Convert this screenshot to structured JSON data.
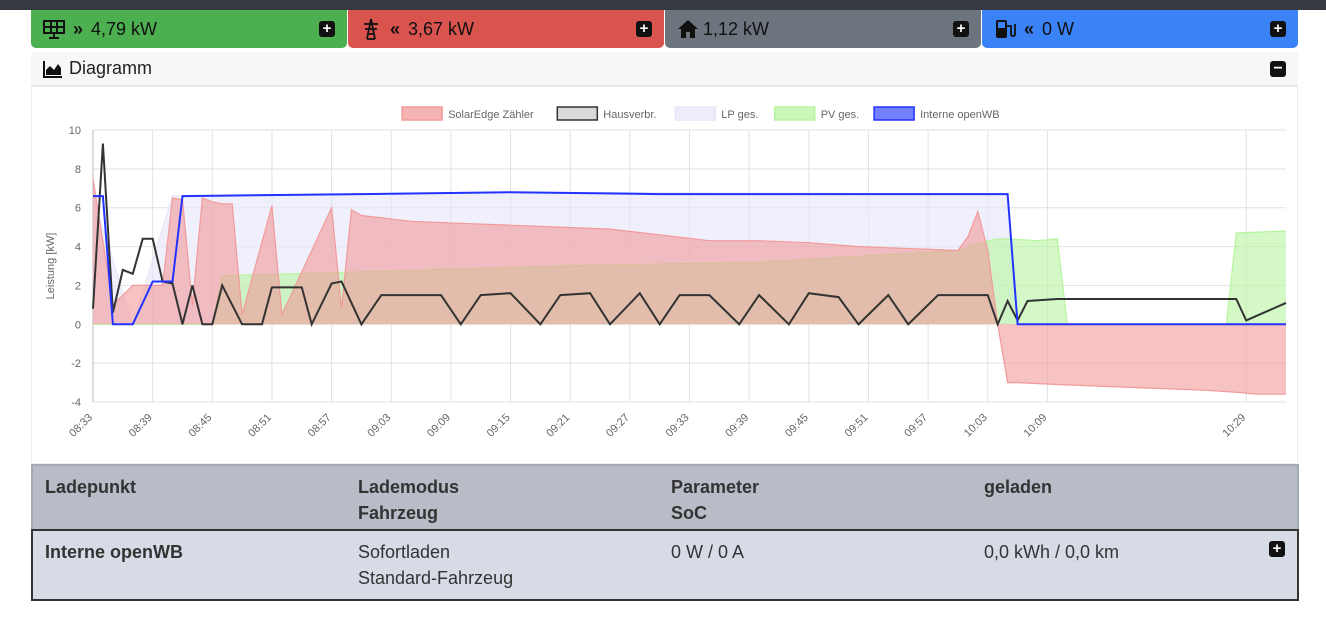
{
  "tiles": {
    "pv": {
      "arrow": "»",
      "value": "4,79 kW",
      "icon": "solar-panel-icon",
      "color": "#4caf50"
    },
    "grid": {
      "arrow": "«",
      "value": "3,67 kW",
      "icon": "power-pylon-icon",
      "color": "#d9534f"
    },
    "house": {
      "value": "1,12 kW",
      "icon": "house-icon",
      "color": "#6c757d"
    },
    "chargepoint": {
      "arrow": "«",
      "value": "0 W",
      "icon": "charging-station-icon",
      "color": "#3b82f6"
    }
  },
  "diagram": {
    "title": "Diagramm"
  },
  "chart_data": {
    "type": "line",
    "ylabel": "Leistung [kW]",
    "ylim": [
      -4,
      10
    ],
    "yticks": [
      10,
      8,
      6,
      4,
      2,
      0,
      -2,
      -4
    ],
    "grid": true,
    "legend_position": "top-center",
    "xticks": [
      "08:33",
      "08:39",
      "08:45",
      "08:51",
      "08:57",
      "09:03",
      "09:09",
      "09:15",
      "09:21",
      "09:27",
      "09:33",
      "09:39",
      "09:45",
      "09:51",
      "09:57",
      "10:03",
      "10:09",
      "10:29"
    ],
    "series": [
      {
        "name": "SolarEdge Zähler",
        "color": "#f29a9a",
        "fill": true,
        "x": [
          "08:33",
          "08:35",
          "08:37",
          "08:40",
          "08:41",
          "08:42",
          "08:43",
          "08:44",
          "08:45",
          "08:46",
          "08:47",
          "08:48",
          "08:51",
          "08:52",
          "08:57",
          "08:58",
          "08:59",
          "09:00",
          "09:05",
          "09:10",
          "09:15",
          "09:20",
          "09:25",
          "09:30",
          "09:35",
          "09:40",
          "09:45",
          "09:50",
          "09:55",
          "10:00",
          "10:01",
          "10:02",
          "10:03",
          "10:04",
          "10:05",
          "10:06",
          "10:10",
          "10:15",
          "10:20",
          "10:25",
          "10:28",
          "10:30",
          "10:33"
        ],
        "y": [
          7.5,
          1.0,
          2.0,
          2.0,
          6.5,
          6.4,
          1.0,
          6.5,
          6.3,
          6.2,
          6.2,
          0.5,
          6.1,
          0.5,
          6.0,
          0.8,
          5.9,
          5.6,
          5.3,
          5.2,
          5.1,
          5.0,
          4.9,
          4.6,
          4.3,
          4.3,
          4.2,
          4.0,
          3.9,
          3.8,
          4.5,
          5.8,
          3.8,
          0,
          -3.0,
          -3.0,
          -3.1,
          -3.2,
          -3.3,
          -3.4,
          -3.5,
          -3.6,
          -3.6
        ]
      },
      {
        "name": "Hausverbr.",
        "color": "#333333",
        "fill": false,
        "x": [
          "08:33",
          "08:34",
          "08:35",
          "08:36",
          "08:37",
          "08:38",
          "08:39",
          "08:40",
          "08:41",
          "08:42",
          "08:43",
          "08:44",
          "08:45",
          "08:46",
          "08:48",
          "08:50",
          "08:51",
          "08:54",
          "08:55",
          "08:57",
          "08:58",
          "09:00",
          "09:02",
          "09:05",
          "09:08",
          "09:10",
          "09:12",
          "09:15",
          "09:18",
          "09:20",
          "09:23",
          "09:25",
          "09:28",
          "09:30",
          "09:32",
          "09:35",
          "09:38",
          "09:40",
          "09:43",
          "09:45",
          "09:48",
          "09:50",
          "09:53",
          "09:55",
          "09:58",
          "10:00",
          "10:03",
          "10:04",
          "10:05",
          "10:06",
          "10:07",
          "10:10",
          "10:12",
          "10:15",
          "10:20",
          "10:25",
          "10:28",
          "10:29",
          "10:33"
        ],
        "y": [
          0.8,
          9.3,
          0.6,
          2.8,
          2.6,
          4.4,
          4.4,
          2.2,
          2.1,
          0,
          2.0,
          0,
          0,
          2.0,
          0,
          0,
          1.9,
          1.9,
          0,
          2.1,
          2.2,
          0,
          1.5,
          1.5,
          1.5,
          0,
          1.5,
          1.6,
          0,
          1.5,
          1.6,
          0,
          1.6,
          0,
          1.5,
          1.5,
          0,
          1.5,
          0,
          1.6,
          1.4,
          0,
          1.5,
          0,
          1.5,
          1.5,
          1.5,
          0,
          1.2,
          0.2,
          1.2,
          1.3,
          1.3,
          1.3,
          1.3,
          1.3,
          1.3,
          0.2,
          1.1
        ]
      },
      {
        "name": "LP ges.",
        "color": "#e6e6fa",
        "fill": true,
        "x": [
          "08:33",
          "08:37",
          "08:41",
          "09:15",
          "10:05",
          "10:06",
          "10:33"
        ],
        "y": [
          6.6,
          0,
          6.6,
          6.8,
          6.7,
          0,
          0
        ]
      },
      {
        "name": "PV ges.",
        "color": "#b7f5a0",
        "fill": true,
        "x": [
          "08:33",
          "08:45",
          "08:46",
          "09:00",
          "09:20",
          "09:40",
          "10:00",
          "10:03",
          "10:04",
          "10:05",
          "10:08",
          "10:10",
          "10:11",
          "10:27",
          "10:28",
          "10:33"
        ],
        "y": [
          0,
          0,
          2.5,
          2.7,
          3.0,
          3.2,
          3.8,
          4.3,
          4.4,
          4.4,
          4.3,
          4.4,
          0,
          0,
          4.7,
          4.8
        ]
      },
      {
        "name": "Interne openWB",
        "color": "#2233ff",
        "fill": false,
        "x": [
          "08:33",
          "08:34",
          "08:35",
          "08:37",
          "08:39",
          "08:41",
          "08:42",
          "09:00",
          "09:15",
          "09:30",
          "10:00",
          "10:05",
          "10:06",
          "10:33"
        ],
        "y": [
          6.6,
          6.6,
          0,
          0,
          2.2,
          2.2,
          6.6,
          6.7,
          6.8,
          6.7,
          6.7,
          6.7,
          0,
          0
        ]
      }
    ]
  },
  "table": {
    "headers": {
      "ladepunkt": "Ladepunkt",
      "lademodus": "Lademodus",
      "fahrzeug": "Fahrzeug",
      "parameter": "Parameter",
      "soc": "SoC",
      "geladen": "geladen"
    },
    "row": {
      "name": "Interne openWB",
      "mode": "Sofortladen",
      "vehicle": "Standard-Fahrzeug",
      "params": "0 W / 0 A",
      "charged": "0,0 kWh / 0,0 km"
    }
  }
}
